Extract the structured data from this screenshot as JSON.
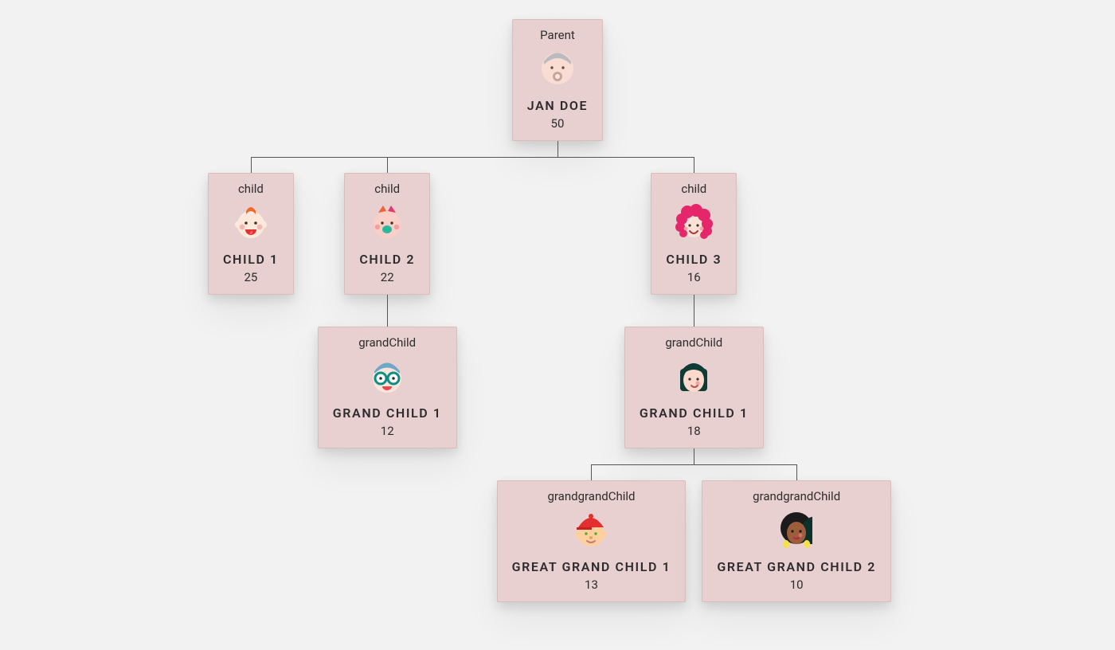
{
  "colors": {
    "card_bg": "#e8d0d0",
    "page_bg": "#f2f2f2"
  },
  "tree": {
    "role": "Parent",
    "name": "JAN DOE",
    "age": "50",
    "avatar": "elder",
    "children": [
      {
        "role": "child",
        "name": "CHILD 1",
        "age": "25",
        "avatar": "baby-red"
      },
      {
        "role": "child",
        "name": "CHILD 2",
        "age": "22",
        "avatar": "toddler",
        "children": [
          {
            "role": "grandChild",
            "name": "GRAND CHILD 1",
            "age": "12",
            "avatar": "glasses-kid"
          }
        ]
      },
      {
        "role": "child",
        "name": "CHILD 3",
        "age": "16",
        "avatar": "pink-hair",
        "children": [
          {
            "role": "grandChild",
            "name": "GRAND CHILD 1",
            "age": "18",
            "avatar": "green-hair",
            "children": [
              {
                "role": "grandgrandChild",
                "name": "GREAT GRAND CHILD 1",
                "age": "13",
                "avatar": "cap-boy"
              },
              {
                "role": "grandgrandChild",
                "name": "GREAT GRAND CHILD 2",
                "age": "10",
                "avatar": "afro-girl"
              }
            ]
          }
        ]
      }
    ]
  }
}
